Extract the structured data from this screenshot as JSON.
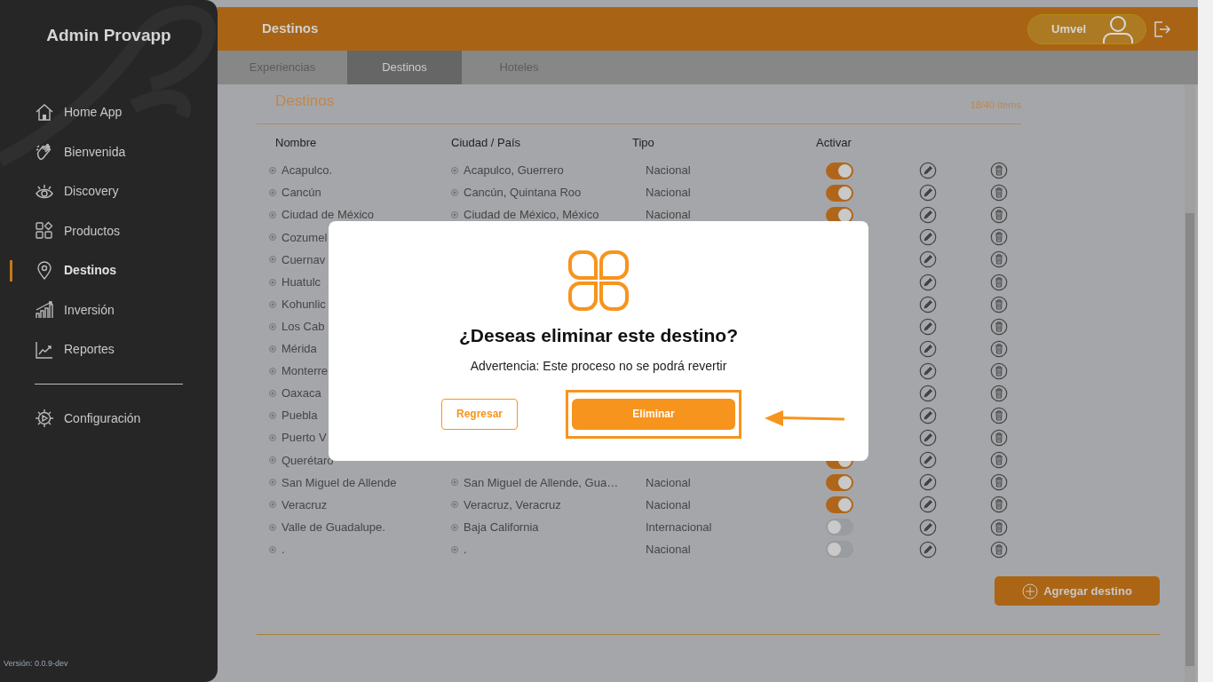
{
  "sidebar": {
    "title": "Admin Provapp",
    "items": [
      {
        "label": "Home App",
        "selected": false
      },
      {
        "label": "Bienvenida",
        "selected": false
      },
      {
        "label": "Discovery",
        "selected": false
      },
      {
        "label": "Productos",
        "selected": false
      },
      {
        "label": "Destinos",
        "selected": true
      },
      {
        "label": "Inversión",
        "selected": false
      },
      {
        "label": "Reportes",
        "selected": false
      }
    ],
    "footer_items": [
      {
        "label": "Configuración",
        "selected": false
      }
    ],
    "version": "Versión: 0.0.9-dev"
  },
  "header": {
    "title": "Destinos",
    "user": "Umvel"
  },
  "tabs": [
    {
      "label": "Experiencias",
      "selected": false
    },
    {
      "label": "Destinos",
      "selected": true
    },
    {
      "label": "Hoteles",
      "selected": false
    }
  ],
  "section": {
    "title": "Destinos",
    "count": "18/40 ítems"
  },
  "table": {
    "columns": [
      "Nombre",
      "Ciudad / País",
      "Tipo",
      "Activar"
    ],
    "rows": [
      {
        "name": "Acapulco.",
        "city": "Acapulco, Guerrero",
        "type": "Nacional",
        "active": true
      },
      {
        "name": "Cancún",
        "city": "Cancún, Quintana Roo",
        "type": "Nacional",
        "active": true
      },
      {
        "name": "Ciudad de México",
        "city": "Ciudad de México, México",
        "type": "Nacional",
        "active": true
      },
      {
        "name": "Cozumel"
      },
      {
        "name": "Cuernav"
      },
      {
        "name": "Huatulc"
      },
      {
        "name": "Kohunlic"
      },
      {
        "name": "Los Cab"
      },
      {
        "name": "Mérida"
      },
      {
        "name": "Monterre"
      },
      {
        "name": "Oaxaca"
      },
      {
        "name": "Puebla"
      },
      {
        "name": "Puerto V"
      },
      {
        "name": "Querétaro",
        "active": true
      },
      {
        "name": "San Miguel de Allende",
        "city": "San Miguel de Allende, Gua…",
        "type": "Nacional",
        "active": true
      },
      {
        "name": "Veracruz",
        "city": "Veracruz, Veracruz",
        "type": "Nacional",
        "active": true
      },
      {
        "name": "Valle de Guadalupe.",
        "city": "Baja California",
        "type": "Internacional",
        "active": false
      },
      {
        "name": ".",
        "city": ".",
        "type": "Nacional",
        "active": false
      }
    ]
  },
  "add_button": "Agregar destino",
  "dialog": {
    "title": "¿Deseas eliminar este destino?",
    "message": "Advertencia: Este proceso no se podrá revertir",
    "buttons": [
      {
        "label": "Regresar",
        "kind": "outline",
        "highlighted": false
      },
      {
        "label": "Eliminar",
        "kind": "primary",
        "highlighted": true
      }
    ]
  }
}
